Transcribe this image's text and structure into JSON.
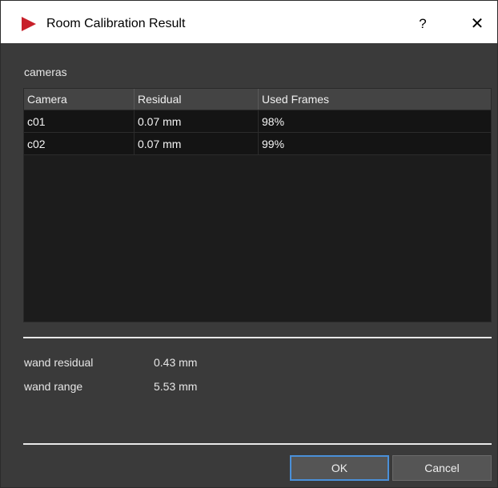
{
  "window": {
    "title": "Room Calibration Result",
    "help_glyph": "?",
    "close_glyph": "✕",
    "accent_color": "#c8202a"
  },
  "cameras": {
    "label": "cameras",
    "columns": [
      "Camera",
      "Residual",
      "Used Frames"
    ],
    "rows": [
      [
        "c01",
        "0.07 mm",
        "98%"
      ],
      [
        "c02",
        "0.07 mm",
        "99%"
      ]
    ]
  },
  "stats": {
    "wand_residual_label": "wand residual",
    "wand_residual_value": "0.43 mm",
    "wand_range_label": "wand range",
    "wand_range_value": "5.53 mm"
  },
  "buttons": {
    "ok": "OK",
    "cancel": "Cancel"
  },
  "icons": {
    "app": "play-triangle-icon"
  }
}
